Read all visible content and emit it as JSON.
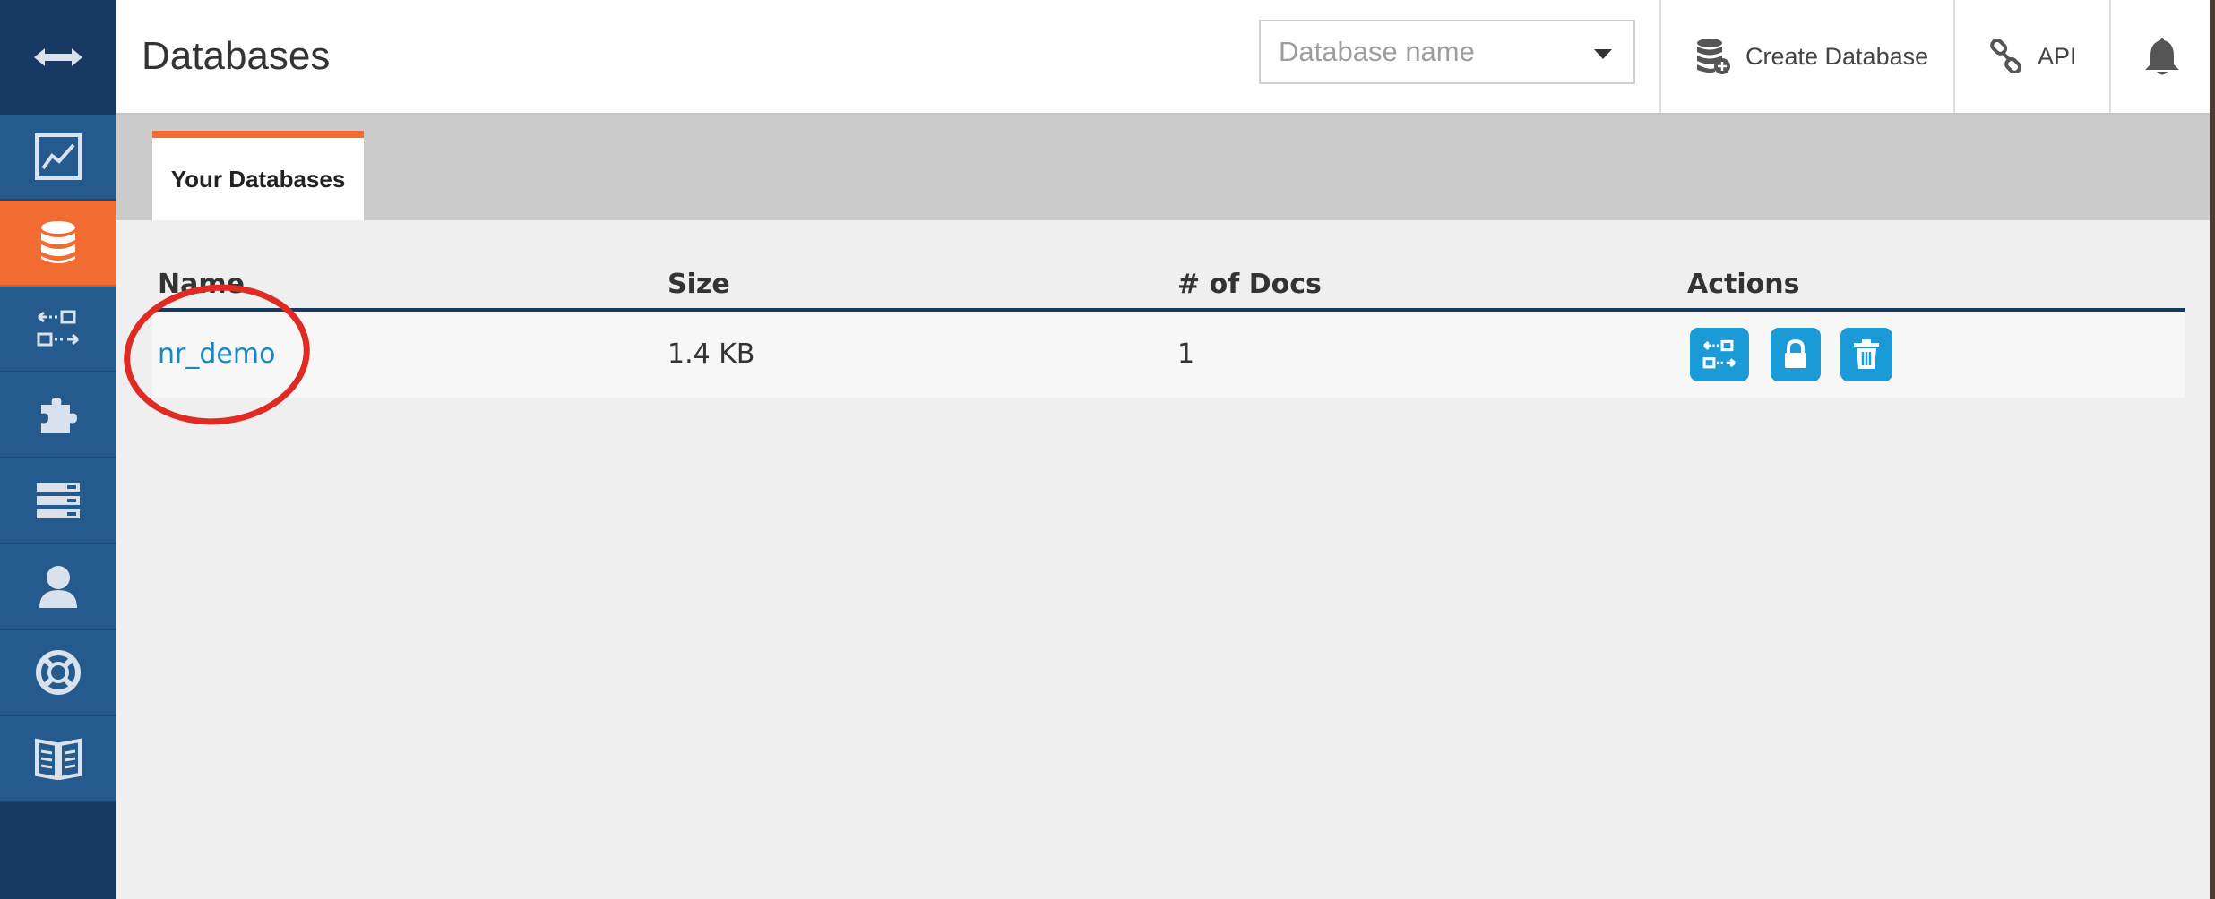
{
  "header": {
    "title": "Databases",
    "search_placeholder": "Database name",
    "create_label": "Create Database",
    "api_label": "API"
  },
  "sidebar": {
    "toggle_icon": "expand-arrows-icon",
    "items": [
      {
        "icon": "activity-chart-icon",
        "active": false
      },
      {
        "icon": "database-icon",
        "active": true
      },
      {
        "icon": "replication-icon",
        "active": false
      },
      {
        "icon": "puzzle-icon",
        "active": false
      },
      {
        "icon": "server-stack-icon",
        "active": false
      },
      {
        "icon": "user-icon",
        "active": false
      },
      {
        "icon": "lifebuoy-icon",
        "active": false
      },
      {
        "icon": "book-icon",
        "active": false
      }
    ]
  },
  "tabs": [
    {
      "label": "Your Databases",
      "active": true
    }
  ],
  "table": {
    "columns": [
      "Name",
      "Size",
      "# of Docs",
      "Actions"
    ],
    "rows": [
      {
        "name": "nr_demo",
        "size": "1.4 KB",
        "docs": "1",
        "actions": [
          "replication-icon",
          "lock-icon",
          "trash-icon"
        ]
      }
    ]
  },
  "colors": {
    "sidebar_bg": "#245a8d",
    "sidebar_active": "#f26b30",
    "accent_blue": "#1a9ad6",
    "link": "#1a87c5",
    "annotation": "#e02a24"
  }
}
